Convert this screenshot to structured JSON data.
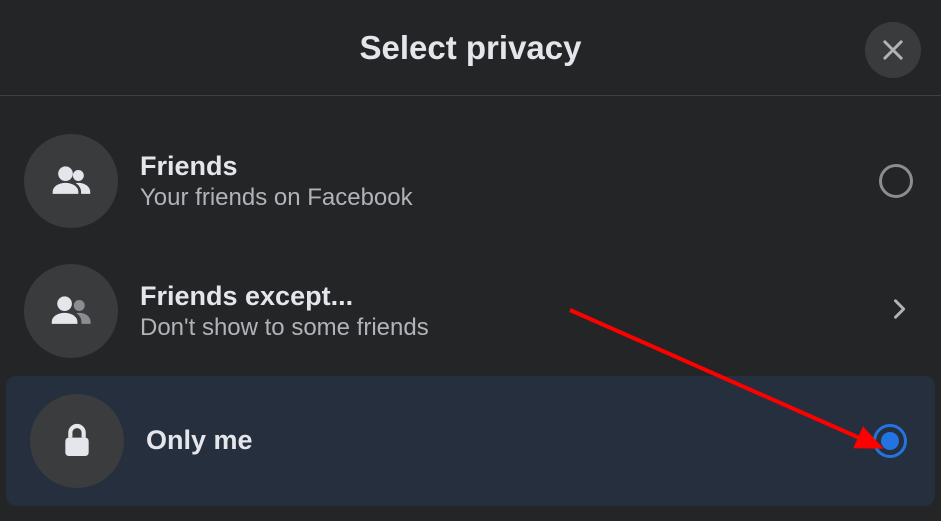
{
  "header": {
    "title": "Select privacy"
  },
  "options": [
    {
      "icon": "friends",
      "title": "Friends",
      "subtitle": "Your friends on Facebook",
      "control": "radio",
      "selected": false
    },
    {
      "icon": "friends-except",
      "title": "Friends except...",
      "subtitle": "Don't show to some friends",
      "control": "chevron",
      "selected": false
    },
    {
      "icon": "lock",
      "title": "Only me",
      "subtitle": "",
      "control": "radio",
      "selected": true
    }
  ],
  "colors": {
    "background": "#242526",
    "accent": "#2374e1",
    "text_primary": "#e4e6eb",
    "text_secondary": "#b0b3b8",
    "annotation": "#ff0000"
  }
}
